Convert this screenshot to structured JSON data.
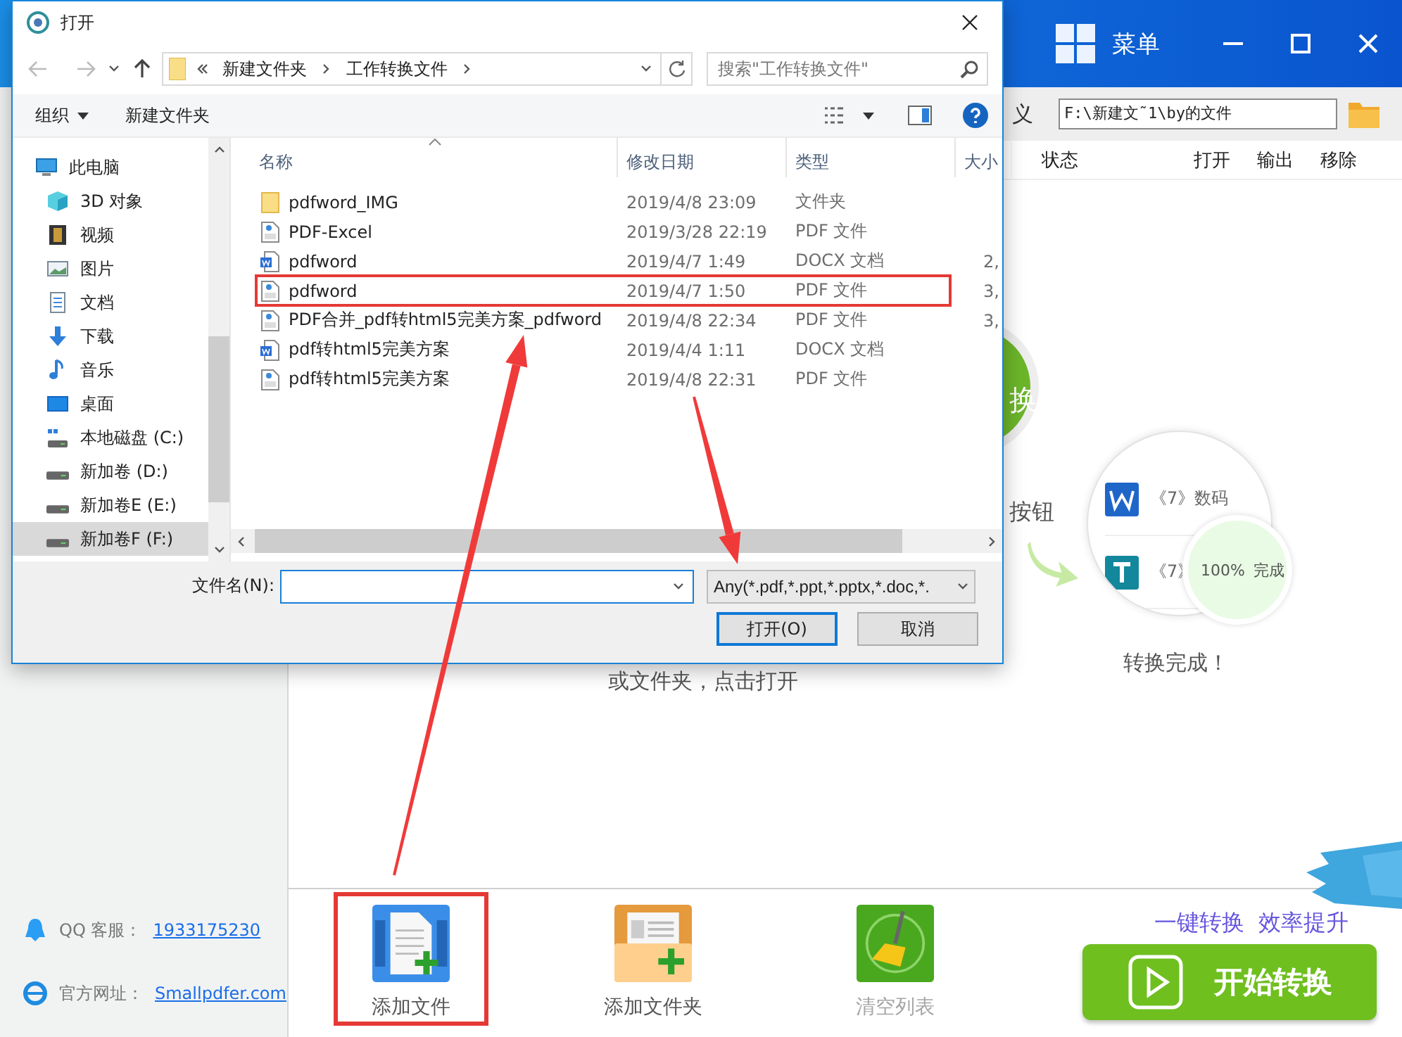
{
  "app": {
    "title_bar": {
      "menu_label": "菜单"
    },
    "path_bar": {
      "label": "义",
      "path": "F:\\新建文˜1\\by的文件"
    },
    "columns": [
      "状态",
      "打开",
      "输出",
      "移除"
    ],
    "contacts": [
      {
        "kind": "qq",
        "label": "QQ 客服：",
        "link": "1933175230"
      },
      {
        "kind": "web",
        "label": "官方网址：",
        "link": "Smallpdfer.com"
      }
    ],
    "illustration": {
      "badge": "换",
      "hint": "按钮",
      "files": [
        {
          "kind": "word",
          "name": "《7》数码"
        },
        {
          "kind": "text",
          "name": "《7》"
        }
      ],
      "progress": "100%",
      "progress_status": "完成",
      "caption": "转换完成！"
    },
    "drop_hint": "或文件夹，点击打开",
    "actions": [
      {
        "kind": "add-file",
        "label": "添加文件",
        "highlighted": true,
        "disabled": false
      },
      {
        "kind": "add-folder",
        "label": "添加文件夹",
        "highlighted": false,
        "disabled": false
      },
      {
        "kind": "clear",
        "label": "清空列表",
        "highlighted": false,
        "disabled": true
      }
    ],
    "slogan": "一键转换  效率提升",
    "start_button": "开始转换"
  },
  "dialog": {
    "title": "打开",
    "breadcrumb": [
      "新建文件夹",
      "工作转换文件"
    ],
    "search": {
      "placeholder": "搜索\"工作转换文件\""
    },
    "commands": [
      {
        "label": "组织",
        "dropdown": true
      },
      {
        "label": "新建文件夹",
        "dropdown": false
      }
    ],
    "nav": [
      {
        "kind": "pc",
        "label": "此电脑",
        "selected": false,
        "children": [
          {
            "kind": "cube",
            "label": "3D 对象",
            "selected": false
          },
          {
            "kind": "video",
            "label": "视频",
            "selected": false
          },
          {
            "kind": "picture",
            "label": "图片",
            "selected": false
          },
          {
            "kind": "docs",
            "label": "文档",
            "selected": false
          },
          {
            "kind": "download",
            "label": "下载",
            "selected": false
          },
          {
            "kind": "music",
            "label": "音乐",
            "selected": false
          },
          {
            "kind": "desktop",
            "label": "桌面",
            "selected": false
          },
          {
            "kind": "system-drive",
            "label": "本地磁盘 (C:)",
            "selected": false
          },
          {
            "kind": "drive",
            "label": "新加卷 (D:)",
            "selected": false
          },
          {
            "kind": "drive",
            "label": "新加卷E (E:)",
            "selected": false
          },
          {
            "kind": "drive",
            "label": "新加卷F (F:)",
            "selected": true
          }
        ]
      }
    ],
    "columns": [
      "名称",
      "修改日期",
      "类型",
      "大小"
    ],
    "files": [
      {
        "kind": "folder",
        "name": "pdfword_IMG",
        "date": "2019/4/8 23:09",
        "type": "文件夹",
        "highlighted": false
      },
      {
        "kind": "pdf",
        "name": "PDF-Excel",
        "date": "2019/3/28 22:19",
        "type": "PDF 文件",
        "highlighted": false
      },
      {
        "kind": "word",
        "name": "pdfword",
        "date": "2019/4/7 1:49",
        "type": "DOCX 文档",
        "size": "2,",
        "highlighted": false
      },
      {
        "kind": "pdf",
        "name": "pdfword",
        "date": "2019/4/7 1:50",
        "type": "PDF 文件",
        "size": "3,",
        "highlighted": true
      },
      {
        "kind": "pdf",
        "name": "PDF合并_pdf转html5完美方案_pdfword",
        "date": "2019/4/8 22:34",
        "type": "PDF 文件",
        "size": "3,",
        "highlighted": false
      },
      {
        "kind": "word",
        "name": "pdf转html5完美方案",
        "date": "2019/4/4 1:11",
        "type": "DOCX 文档",
        "highlighted": false
      },
      {
        "kind": "pdf",
        "name": "pdf转html5完美方案",
        "date": "2019/4/8 22:31",
        "type": "PDF 文件",
        "highlighted": false
      }
    ],
    "filename_label": "文件名(N):",
    "filter": "Any(*.pdf,*.ppt,*.pptx,*.doc,*.",
    "buttons": [
      {
        "label": "打开(O)",
        "default": true
      },
      {
        "label": "取消",
        "default": false
      }
    ]
  }
}
